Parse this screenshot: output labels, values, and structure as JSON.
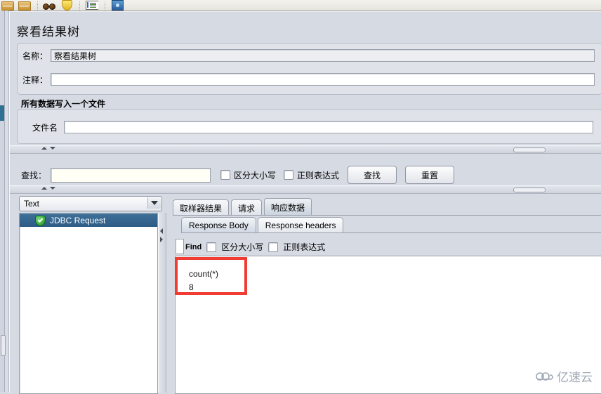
{
  "window": {
    "title": "察看结果树"
  },
  "toolbar": {
    "icons": [
      "folder-open-icon",
      "folder-icon",
      "glasses-icon",
      "shield-icon",
      "properties-icon",
      "blue-info-icon"
    ]
  },
  "form": {
    "name_label": "名称：",
    "name_value": "察看结果树",
    "comment_label": "注释：",
    "comment_value": ""
  },
  "file_group": {
    "title": "所有数据写入一个文件",
    "filename_label": "文件名",
    "filename_value": ""
  },
  "search": {
    "label": "查找：",
    "value": "",
    "case_sensitive_label": "区分大小写",
    "regex_label": "正则表达式",
    "find_button": "查找",
    "reset_button": "重置"
  },
  "left_panel": {
    "renderer_selected": "Text",
    "tree_items": [
      {
        "label": "JDBC Request",
        "icon": "green-shield-success-icon"
      }
    ]
  },
  "result_tabs": [
    {
      "label": "取样器结果",
      "active": false
    },
    {
      "label": "请求",
      "active": false
    },
    {
      "label": "响应数据",
      "active": true
    }
  ],
  "response_tabs": [
    {
      "label": "Response Body",
      "active": true
    },
    {
      "label": "Response headers",
      "active": false
    }
  ],
  "response_toolbar": {
    "find_label": "Find",
    "case_sensitive_label": "区分大小写",
    "regex_label": "正则表达式"
  },
  "response_body": {
    "lines": [
      "count(*)",
      "8"
    ],
    "text": "count(*)\n8",
    "highlight_color": "#f03c32"
  },
  "watermark": {
    "text": "亿速云",
    "icon": "cloud-icon"
  }
}
